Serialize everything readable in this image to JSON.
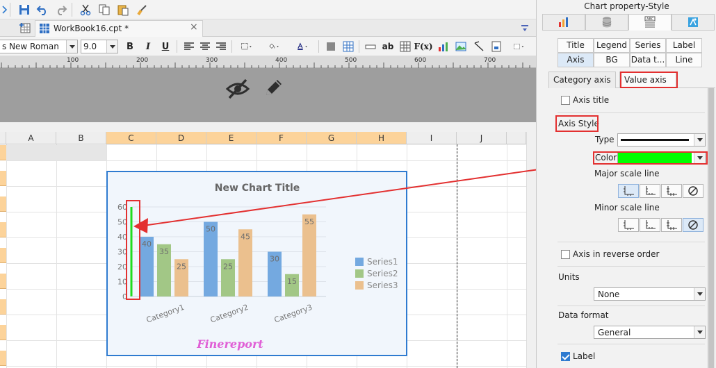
{
  "designer": {
    "doc_tab": "WorkBook16.cpt *",
    "font_name": "s New Roman",
    "font_size": "9.0",
    "bold": "B",
    "italic": "I",
    "underline": "U",
    "ab_label": "ab",
    "formula_label": "F(x)",
    "ruler_ticks": [
      "100",
      "200",
      "300",
      "400",
      "500",
      "600",
      "700"
    ],
    "columns": [
      "A",
      "B",
      "C",
      "D",
      "E",
      "F",
      "G",
      "H",
      "I",
      "J"
    ],
    "selected_columns": [
      "C",
      "D",
      "E",
      "F",
      "G",
      "H"
    ]
  },
  "chart_data": {
    "type": "bar",
    "title": "New Chart Title",
    "categories": [
      "Category1",
      "Category2",
      "Category3"
    ],
    "series": [
      {
        "name": "Series1",
        "values": [
          40,
          50,
          30
        ],
        "color": "#74a9e0"
      },
      {
        "name": "Series2",
        "values": [
          35,
          25,
          15
        ],
        "color": "#a2c786"
      },
      {
        "name": "Series3",
        "values": [
          25,
          45,
          55
        ],
        "color": "#ebc08e"
      }
    ],
    "y_ticks": [
      "0",
      "10",
      "20",
      "30",
      "40",
      "50",
      "60"
    ],
    "ylim": [
      0,
      60
    ],
    "axis_color": "#1edc1e",
    "legend_position": "right",
    "watermark": "Finereport",
    "watermark_color": "#e05fd6"
  },
  "panel": {
    "title": "Chart property-Style",
    "style_tabs_row1": [
      "Title",
      "Legend",
      "Series",
      "Label"
    ],
    "style_tabs_row2": [
      "Axis",
      "BG",
      "Data t...",
      "Line"
    ],
    "axis_tabs": [
      "Category axis",
      "Value axis"
    ],
    "axis_title_label": "Axis title",
    "axis_style_label": "Axis Style",
    "type_label": "Type",
    "color_label": "Color",
    "color_value": "#00ff00",
    "major_scale_label": "Major scale line",
    "minor_scale_label": "Minor scale line",
    "reverse_label": "Axis in reverse order",
    "units_label": "Units",
    "units_value": "None",
    "data_format_label": "Data format",
    "data_format_value": "General",
    "label_checkbox": "Label"
  }
}
